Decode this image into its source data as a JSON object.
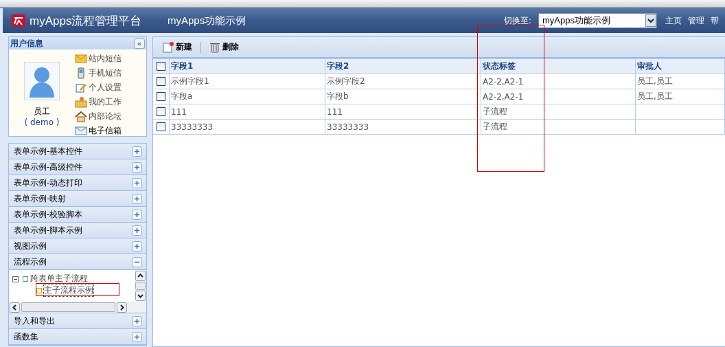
{
  "header": {
    "logo_text": "myApps流程管理平台",
    "app_title": "myApps功能示例",
    "switch_label": "切换至:",
    "switch_value": "myApps功能示例",
    "links": [
      "主页",
      "管理",
      "帮"
    ]
  },
  "user_panel": {
    "title": "用户信息",
    "collapse_icon": "«",
    "name": "员工",
    "account": "( demo )",
    "links": [
      {
        "label": "站内短信",
        "kind": "mail"
      },
      {
        "label": "手机短信",
        "kind": "phone"
      },
      {
        "label": "个人设置",
        "kind": "edit"
      },
      {
        "label": "我的工作",
        "kind": "work"
      },
      {
        "label": "内部论坛",
        "kind": "home"
      },
      {
        "label": "电子信箱",
        "kind": "mail"
      }
    ]
  },
  "accordion": [
    {
      "label": "表单示例-基本控件",
      "expanded": false
    },
    {
      "label": "表单示例-高级控件",
      "expanded": false
    },
    {
      "label": "表单示例-动态打印",
      "expanded": false
    },
    {
      "label": "表单示例-映射",
      "expanded": false
    },
    {
      "label": "表单示例-校验脚本",
      "expanded": false
    },
    {
      "label": "表单示例-脚本示例",
      "expanded": false
    },
    {
      "label": "视图示例",
      "expanded": false
    },
    {
      "label": "流程示例",
      "expanded": true,
      "tree": [
        {
          "label": "跨表单主子流程",
          "expanded": true,
          "selected": false,
          "children": [
            {
              "label": "主子流程示例",
              "selected": true
            }
          ]
        }
      ]
    },
    {
      "label": "导入和导出",
      "expanded": false
    },
    {
      "label": "函数集",
      "expanded": false
    }
  ],
  "toolbar": {
    "buttons": [
      {
        "label": "新建",
        "kind": "new"
      },
      {
        "label": "删除",
        "kind": "delete"
      }
    ]
  },
  "table": {
    "all_checked": false,
    "columns": [
      "字段1",
      "字段2",
      "状态标签",
      "审批人"
    ],
    "rows": [
      {
        "checked": false,
        "cells": [
          "示例字段1",
          "示例字段2",
          "A2-2,A2-1",
          "员工,员工"
        ]
      },
      {
        "checked": false,
        "cells": [
          "字段a",
          "字段b",
          "A2-2,A2-1",
          "员工,员工"
        ]
      },
      {
        "checked": false,
        "cells": [
          "111",
          "111",
          "子流程",
          ""
        ]
      },
      {
        "checked": false,
        "cells": [
          "33333333",
          "33333333",
          "子流程",
          ""
        ]
      }
    ]
  }
}
